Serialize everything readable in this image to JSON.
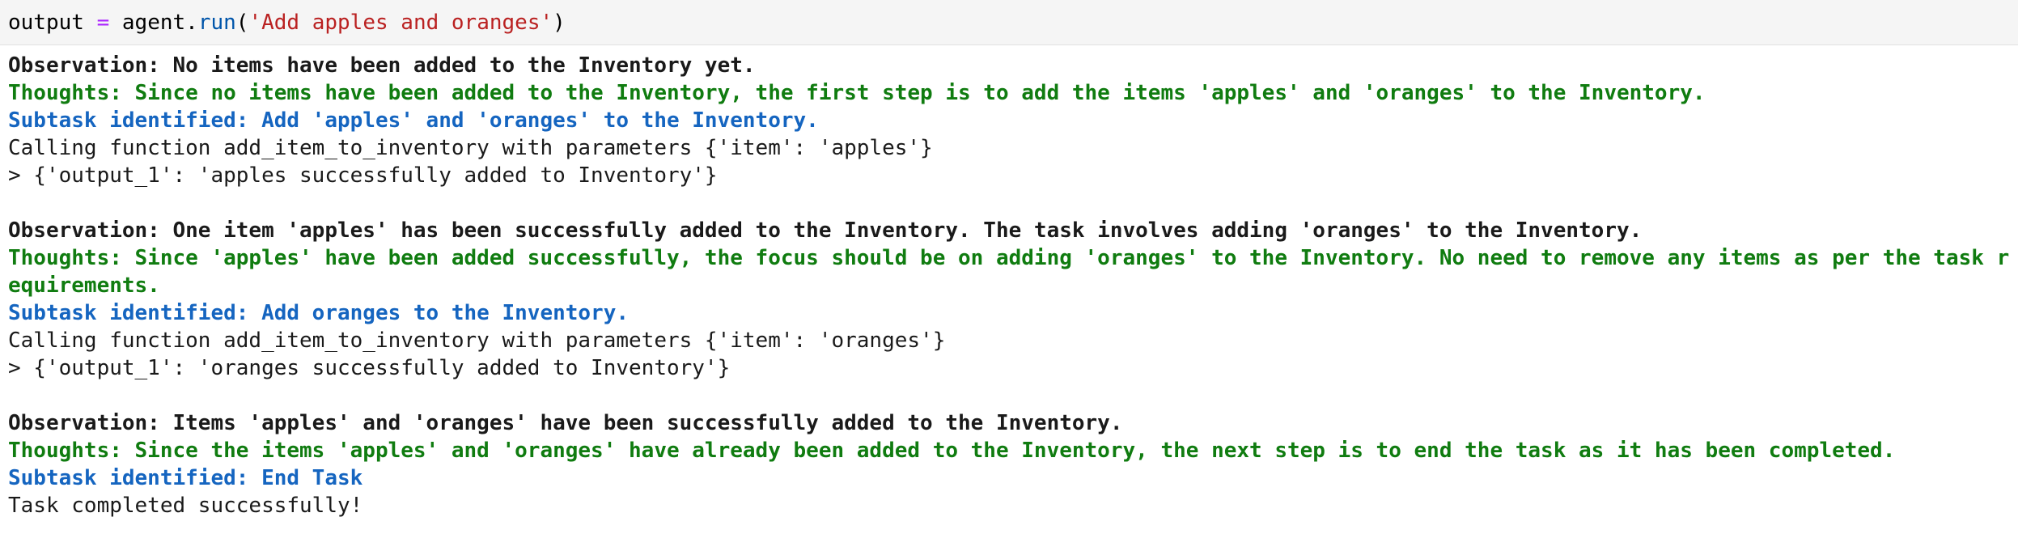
{
  "input_cell": {
    "var": "output",
    "op": "=",
    "obj": "agent",
    "dot": ".",
    "fn": "run",
    "paren_open": "(",
    "str": "'Add apples and oranges'",
    "paren_close": ")"
  },
  "output_lines": [
    {
      "type": "obs",
      "text": "Observation: No items have been added to the Inventory yet."
    },
    {
      "type": "thought",
      "text": "Thoughts: Since no items have been added to the Inventory, the first step is to add the items 'apples' and 'oranges' to the Inventory."
    },
    {
      "type": "subtask",
      "text": "Subtask identified: Add 'apples' and 'oranges' to the Inventory."
    },
    {
      "type": "plain",
      "text": "Calling function add_item_to_inventory with parameters {'item': 'apples'}"
    },
    {
      "type": "plain",
      "text": "> {'output_1': 'apples successfully added to Inventory'}"
    },
    {
      "type": "blank",
      "text": ""
    },
    {
      "type": "obs",
      "text": "Observation: One item 'apples' has been successfully added to the Inventory. The task involves adding 'oranges' to the Inventory."
    },
    {
      "type": "thought",
      "text": "Thoughts: Since 'apples' have been added successfully, the focus should be on adding 'oranges' to the Inventory. No need to remove any items as per the task r"
    },
    {
      "type": "thought",
      "text": "equirements."
    },
    {
      "type": "subtask",
      "text": "Subtask identified: Add oranges to the Inventory."
    },
    {
      "type": "plain",
      "text": "Calling function add_item_to_inventory with parameters {'item': 'oranges'}"
    },
    {
      "type": "plain",
      "text": "> {'output_1': 'oranges successfully added to Inventory'}"
    },
    {
      "type": "blank",
      "text": ""
    },
    {
      "type": "obs",
      "text": "Observation: Items 'apples' and 'oranges' have been successfully added to the Inventory."
    },
    {
      "type": "thought",
      "text": "Thoughts: Since the items 'apples' and 'oranges' have already been added to the Inventory, the next step is to end the task as it has been completed."
    },
    {
      "type": "subtask",
      "text": "Subtask identified: End Task"
    },
    {
      "type": "plain",
      "text": "Task completed successfully!"
    }
  ],
  "colors": {
    "cell_background": "#f5f5f5",
    "observation": "#1a1a1a",
    "thoughts": "#107c10",
    "subtask": "#1565c0",
    "string_literal": "#ba2121",
    "operator": "#aa22ff",
    "function_name": "#0055aa"
  }
}
